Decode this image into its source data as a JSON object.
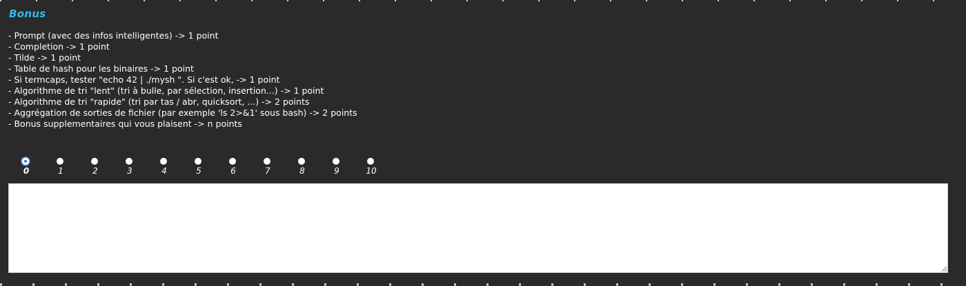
{
  "section": {
    "title": "Bonus"
  },
  "criteria": [
    "- Prompt (avec des infos intelligentes) -> 1 point",
    "- Completion -> 1 point",
    "- Tilde -> 1 point",
    "- Table de hash pour les binaires -> 1 point",
    "- Si termcaps, tester \"echo 42 | ./mysh \". Si c'est ok, -> 1 point",
    "- Algorithme de tri \"lent\" (tri à bulle, par sélection, insertion...) -> 1 point",
    "- Algorithme de tri \"rapide\" (tri par tas / abr, quicksort, ...) -> 2 points",
    "- Aggrégation de sorties de fichier (par exemple 'ls 2>&1' sous bash) -> 2 points",
    "- Bonus supplementaires qui vous plaisent -> n points"
  ],
  "score": {
    "options": [
      "0",
      "1",
      "2",
      "3",
      "4",
      "5",
      "6",
      "7",
      "8",
      "9",
      "10"
    ],
    "selected": "0"
  },
  "comment": {
    "value": "",
    "placeholder": ""
  },
  "colors": {
    "panel_bg": "#2a2a2a",
    "title": "#35b8ea",
    "text": "#ffffff",
    "radio_selected_ring": "#6ba3e8"
  }
}
